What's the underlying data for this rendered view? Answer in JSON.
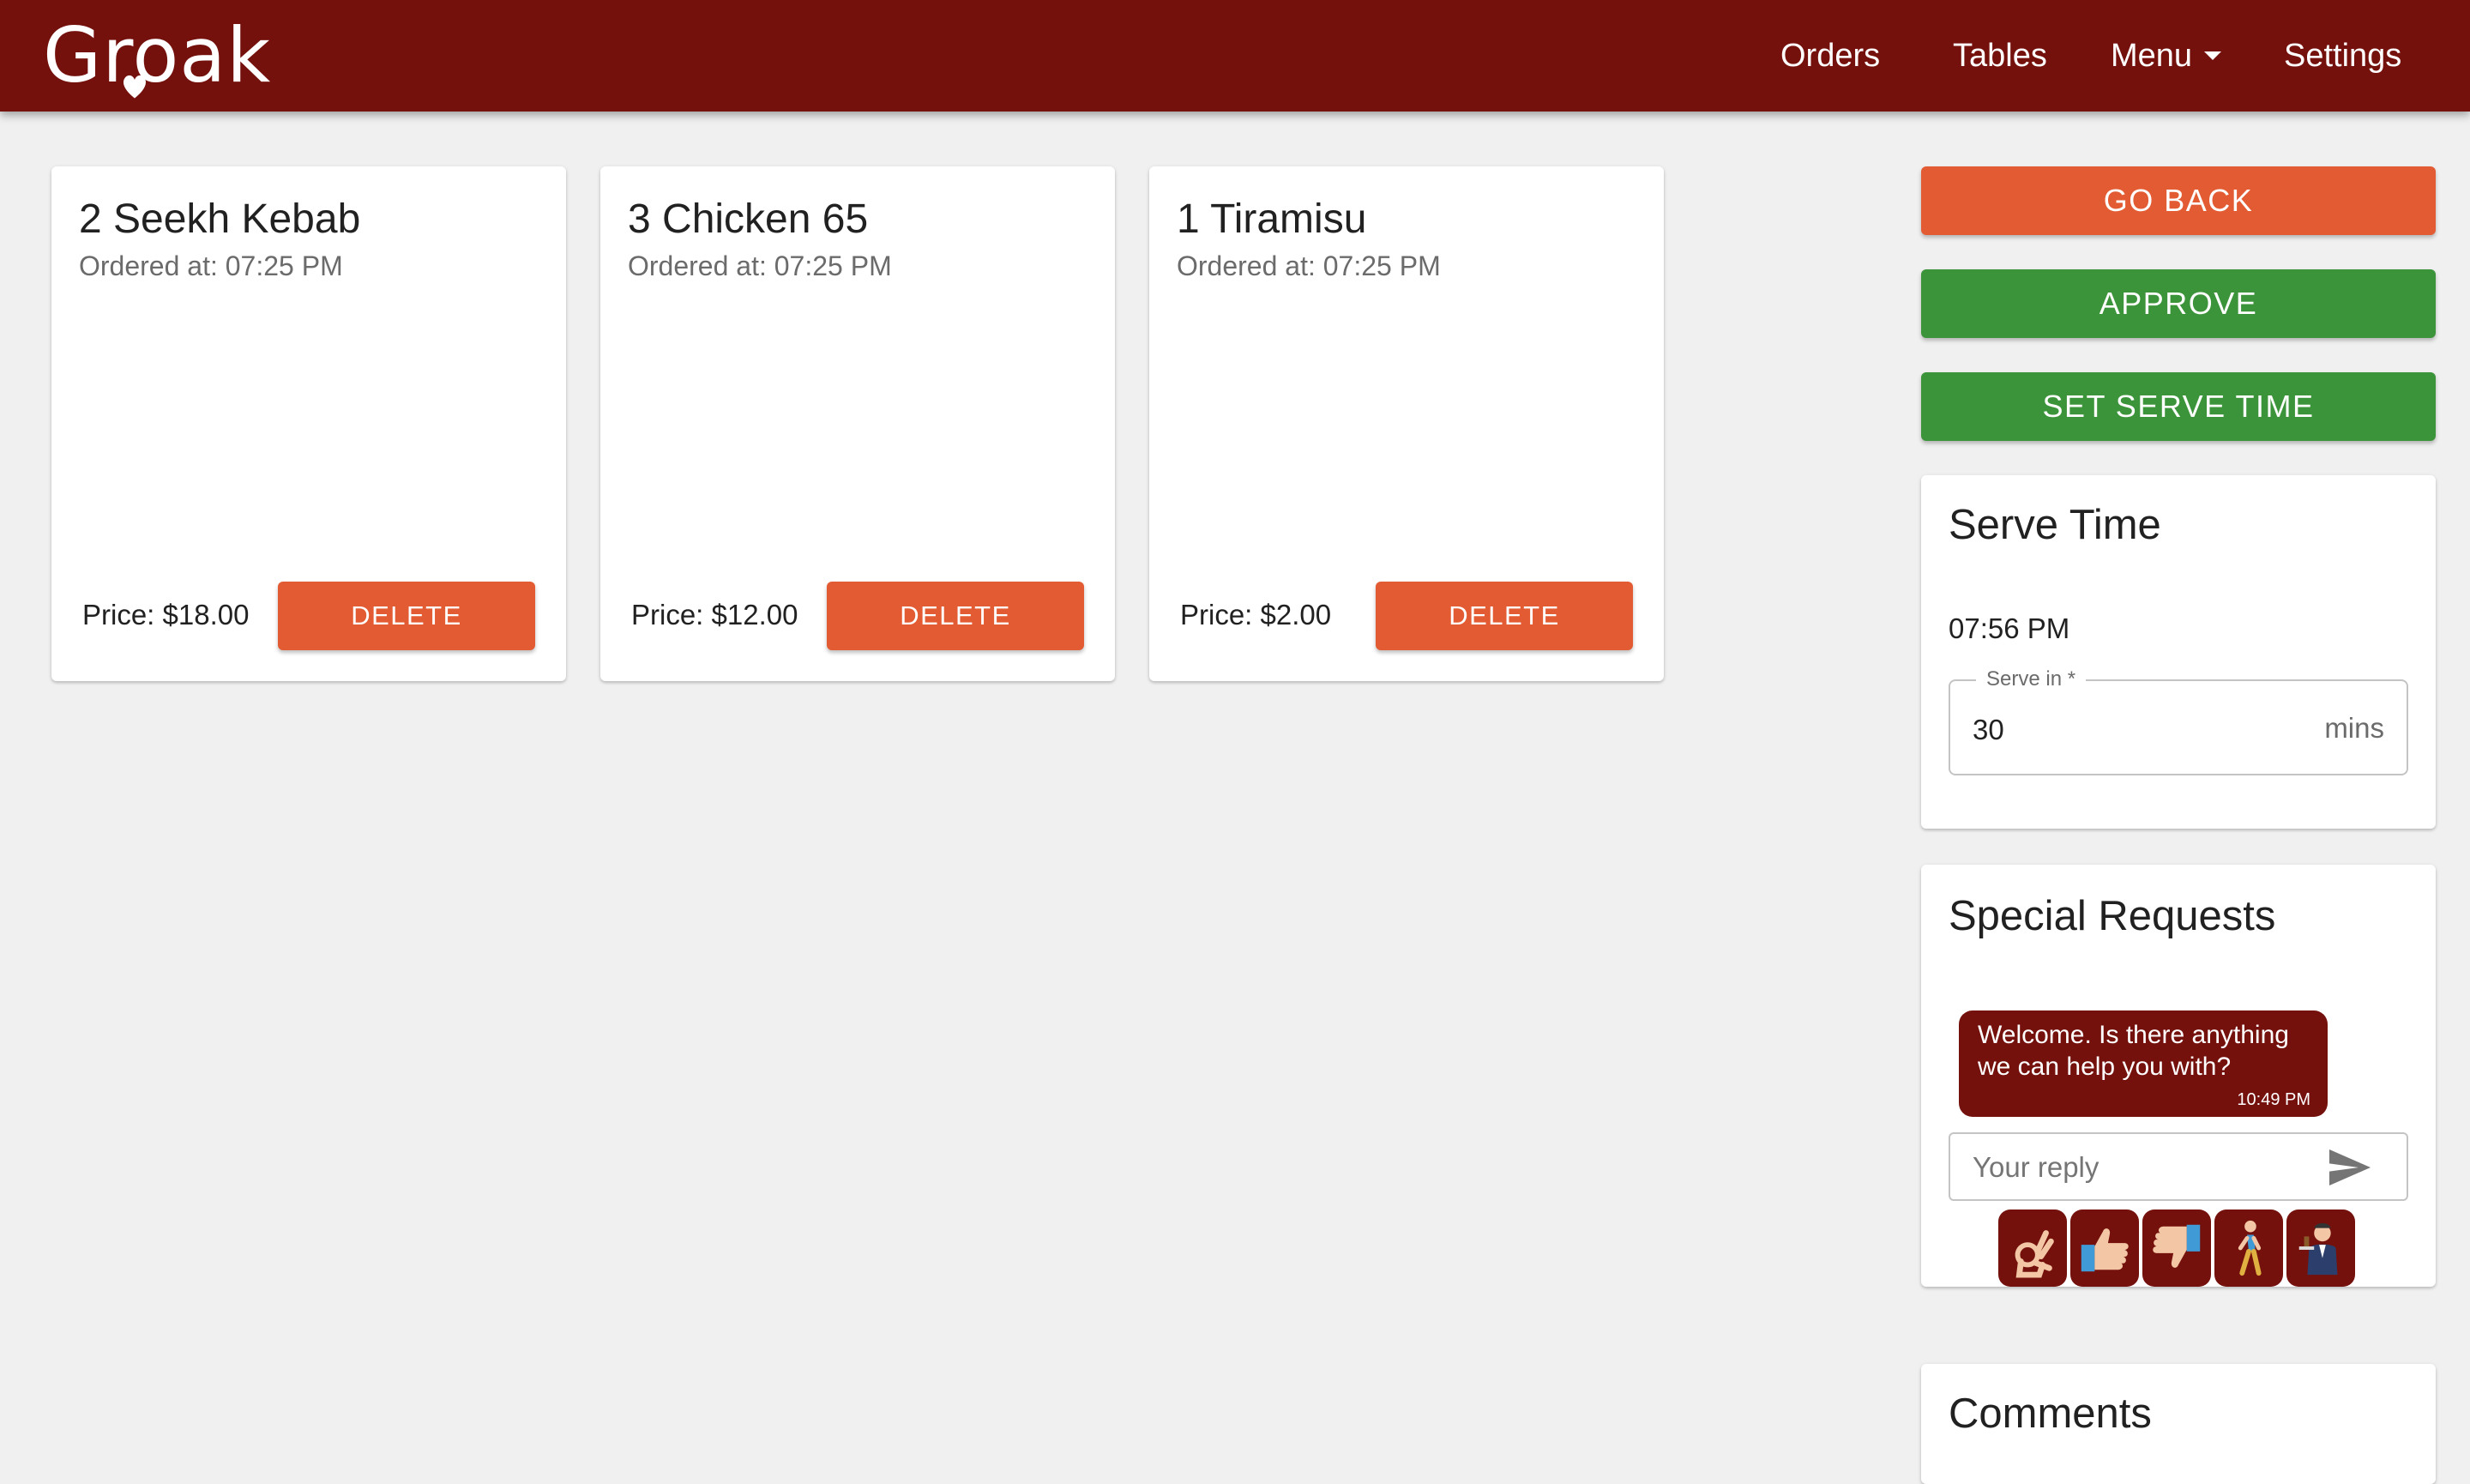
{
  "header": {
    "brand": "Groak",
    "nav": [
      "Orders",
      "Tables",
      "Menu",
      "Settings"
    ]
  },
  "orders": [
    {
      "title": "2 Seekh Kebab",
      "ordered_at": "Ordered at: 07:25 PM",
      "price": "Price: $18.00",
      "delete_label": "DELETE"
    },
    {
      "title": "3 Chicken 65",
      "ordered_at": "Ordered at: 07:25 PM",
      "price": "Price: $12.00",
      "delete_label": "DELETE"
    },
    {
      "title": "1 Tiramisu",
      "ordered_at": "Ordered at: 07:25 PM",
      "price": "Price: $2.00",
      "delete_label": "DELETE"
    }
  ],
  "actions": {
    "go_back": "GO BACK",
    "approve": "APPROVE",
    "set_serve_time": "SET SERVE TIME"
  },
  "serve_time": {
    "title": "Serve Time",
    "time": "07:56 PM",
    "field_label": "Serve in *",
    "field_value": "30",
    "field_unit": "mins"
  },
  "special_requests": {
    "title": "Special Requests",
    "messages": [
      {
        "text": "Welcome. Is there anything we can help you with?",
        "time": "10:49 PM"
      }
    ],
    "reply_placeholder": "Your reply",
    "quick_replies": [
      "ok-hand-icon",
      "thumbs-up-icon",
      "thumbs-down-icon",
      "walking-person-icon",
      "waiter-icon"
    ]
  },
  "comments": {
    "title": "Comments"
  },
  "colors": {
    "brand": "#74110d",
    "orange": "#e35b32",
    "green": "#3c943a",
    "background": "#f0f0f0"
  }
}
